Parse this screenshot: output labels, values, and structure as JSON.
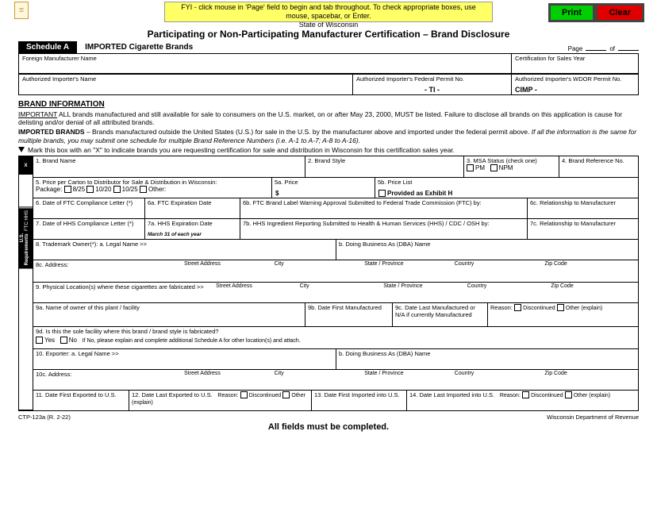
{
  "topbar": {
    "fyi": "FYI - click mouse in 'Page' field to begin and tab throughout. To check appropriate boxes, use mouse, spacebar, or Enter.",
    "print": "Print",
    "clear": "Clear"
  },
  "header": {
    "state": "State of Wisconsin",
    "title": "Participating or Non-Participating Manufacturer Certification – Brand Disclosure"
  },
  "schedule": {
    "badge": "Schedule A",
    "title": "IMPORTED Cigarette Brands",
    "page_label": "Page",
    "of_label": "of"
  },
  "head_grid": {
    "foreign": "Foreign Manufacturer Name",
    "certyear": "Certification for Sales Year",
    "importer": "Authorized Importer's Name",
    "fedpermit": "Authorized Importer's Federal Permit No.",
    "fedpermit_val": "- TI -",
    "wdor": "Authorized Importer's WDOR Permit No.",
    "wdor_val": "CIMP -"
  },
  "brandinfo": {
    "heading": "BRAND INFORMATION",
    "important_label": "IMPORTANT",
    "important_text": " ALL brands manufactured and still available for sale to consumers on the U.S. market, on or after May 23, 2000, MUST be listed. Failure to disclose all brands on this application is cause for delisting and/or denial of all attributed brands.",
    "imported_label": "IMPORTED BRANDS",
    "imported_text": " – Brands manufactured outside the United States (U.S.) for sale in the U.S. by the manufacturer above and imported under the federal permit above. ",
    "imported_italic": "If all the information is the same for multiple brands, you may submit one schedule for multiple Brand Reference Numbers (i.e. A-1 to A-7; A-8 to A-16).",
    "mark_text": "Mark this box with an \"X\" to indicate brands you are requesting certification for sale and distribution in Wisconsin for this certification sales year."
  },
  "rot": {
    "x": "X",
    "req": "U.S. Requirements",
    "ftc": "FTC",
    "hhs": "HHS"
  },
  "r1": {
    "c1": "1. Brand Name",
    "c2": "2. Brand Style",
    "c3": "3. MSA Status (check one)",
    "c3a": "PM",
    "c3b": "NPM",
    "c4": "4. Brand Reference No."
  },
  "r2": {
    "label": "5. Price per Carton to Distributor for Sale & Distribution in Wisconsin:",
    "pkg": "Package:",
    "o1": "8/25",
    "o2": "10/20",
    "o3": "10/25",
    "o4": "Other:",
    "price": "5a. Price",
    "dollar": "$",
    "pl": "5b. Price List",
    "exh": "Provided as Exhibit H"
  },
  "r3": {
    "c1": "6. Date of FTC Compliance Letter  (*)",
    "c2": "6a. FTC Expiration Date",
    "c3": "6b. FTC Brand Label Warning Approval Submitted to Federal Trade Commission (FTC) by:",
    "c4": "6c. Relationship to Manufacturer"
  },
  "r4": {
    "c1": "7. Date of HHS Compliance Letter  (*)",
    "c2": "7a. HHS Expiration Date",
    "c2v": "March 31 of each year",
    "c3": "7b. HHS Ingredient Reporting Submitted to Health & Human Services (HHS) / CDC / OSH by:",
    "c4": "7c. Relationship to Manufacturer"
  },
  "r5": {
    "c1": "8. Trademark Owner(*): a. Legal Name  >>",
    "c2": "b. Doing Business As (DBA) Name"
  },
  "r6": {
    "label": "8c. Address:",
    "sa": "Street Address",
    "city": "City",
    "sp": "State / Province",
    "co": "Country",
    "zip": "Zip Code"
  },
  "r7": {
    "label": "9. Physical Location(s) where these cigarettes are fabricated  >>",
    "sa": "Street Address",
    "city": "City",
    "sp": "State / Province",
    "co": "Country",
    "zip": "Zip Code"
  },
  "r8": {
    "c1": "9a. Name of owner of this plant / facility",
    "c2": "9b. Date First Manufactured",
    "c3": "9c. Date Last Manufactured or N/A if currently Manufactured",
    "reason": "Reason:",
    "disc": "Discontinued",
    "oth": "Other (explain)"
  },
  "r9": {
    "q": "9d. Is this the sole facility where this brand / brand style is fabricated?",
    "yes": "Yes",
    "no": "No",
    "note": "If No, please explain and complete additional Schedule A for other location(s) and attach."
  },
  "r10": {
    "c1": "10. Exporter: a. Legal Name  >>",
    "c2": "b. Doing Business As (DBA) Name"
  },
  "r10c": {
    "label": "10c. Address:",
    "sa": "Street Address",
    "city": "City",
    "sp": "State / Province",
    "co": "Country",
    "zip": "Zip Code"
  },
  "r11": {
    "c1": "11. Date First Exported to U.S.",
    "c2": "12. Date Last Exported to U.S.",
    "reason": "Reason:",
    "disc": "Discontinued",
    "oth": "Other (explain)",
    "c3": "13. Date First Imported into U.S.",
    "c4": "14. Date Last Imported into U.S."
  },
  "footer": {
    "form": "CTP-123a (R. 2-22)",
    "all": "All fields must be completed.",
    "dept": "Wisconsin Department of Revenue"
  }
}
